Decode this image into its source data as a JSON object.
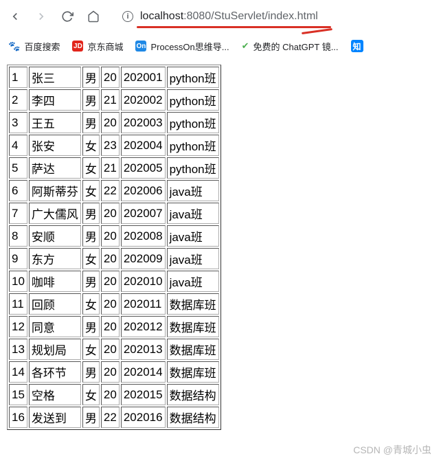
{
  "url": {
    "host": "localhost",
    "port": ":8080",
    "path": "/StuServlet/index.html"
  },
  "bookmarks": {
    "baidu": "百度搜索",
    "jd_icon": "JD",
    "jd": "京东商城",
    "on_icon": "On",
    "processon": "ProcessOn思维导...",
    "chatgpt": "免费的 ChatGPT 镜...",
    "zhi_icon": "知"
  },
  "table": {
    "rows": [
      {
        "id": "1",
        "name": "张三",
        "gender": "男",
        "age": "20",
        "sno": "202001",
        "cls": "python班"
      },
      {
        "id": "2",
        "name": "李四",
        "gender": "男",
        "age": "21",
        "sno": "202002",
        "cls": "python班"
      },
      {
        "id": "3",
        "name": "王五",
        "gender": "男",
        "age": "20",
        "sno": "202003",
        "cls": "python班"
      },
      {
        "id": "4",
        "name": "张安",
        "gender": "女",
        "age": "23",
        "sno": "202004",
        "cls": "python班"
      },
      {
        "id": "5",
        "name": "萨达",
        "gender": "女",
        "age": "21",
        "sno": "202005",
        "cls": "python班"
      },
      {
        "id": "6",
        "name": "阿斯蒂芬",
        "gender": "女",
        "age": "22",
        "sno": "202006",
        "cls": "java班"
      },
      {
        "id": "7",
        "name": "广大儒风",
        "gender": "男",
        "age": "20",
        "sno": "202007",
        "cls": "java班"
      },
      {
        "id": "8",
        "name": "安顺",
        "gender": "男",
        "age": "20",
        "sno": "202008",
        "cls": "java班"
      },
      {
        "id": "9",
        "name": "东方",
        "gender": "女",
        "age": "20",
        "sno": "202009",
        "cls": "java班"
      },
      {
        "id": "10",
        "name": "咖啡",
        "gender": "男",
        "age": "20",
        "sno": "202010",
        "cls": "java班"
      },
      {
        "id": "11",
        "name": "回顾",
        "gender": "女",
        "age": "20",
        "sno": "202011",
        "cls": "数据库班"
      },
      {
        "id": "12",
        "name": "同意",
        "gender": "男",
        "age": "20",
        "sno": "202012",
        "cls": "数据库班"
      },
      {
        "id": "13",
        "name": "规划局",
        "gender": "女",
        "age": "20",
        "sno": "202013",
        "cls": "数据库班"
      },
      {
        "id": "14",
        "name": "各环节",
        "gender": "男",
        "age": "20",
        "sno": "202014",
        "cls": "数据库班"
      },
      {
        "id": "15",
        "name": "空格",
        "gender": "女",
        "age": "20",
        "sno": "202015",
        "cls": "数据结构"
      },
      {
        "id": "16",
        "name": "发送到",
        "gender": "男",
        "age": "22",
        "sno": "202016",
        "cls": "数据结构"
      }
    ]
  },
  "watermark": "CSDN @青城小虫"
}
